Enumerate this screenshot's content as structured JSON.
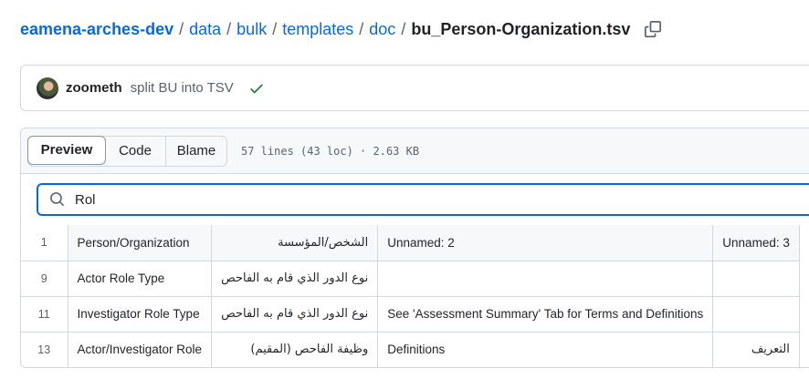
{
  "breadcrumb": {
    "repo": "eamena-arches-dev",
    "parts": [
      "data",
      "bulk",
      "templates",
      "doc"
    ],
    "file": "bu_Person-Organization.tsv",
    "separator": "/"
  },
  "commit": {
    "author": "zoometh",
    "message": "split BU into TSV",
    "status": "success"
  },
  "viewer": {
    "tabs": {
      "preview": "Preview",
      "code": "Code",
      "blame": "Blame"
    },
    "meta": "57 lines (43 loc) · 2.63 KB"
  },
  "search": {
    "value": "Rol"
  },
  "table": {
    "header": {
      "line": "1",
      "cells": [
        "Person/Organization",
        "الشخص/المؤسسة",
        "Unnamed: 2",
        "Unnamed: 3"
      ]
    },
    "rows": [
      {
        "line": "9",
        "cells": [
          "Actor Role Type",
          "نوع الدور الذي قام به الفاحص",
          "",
          ""
        ]
      },
      {
        "line": "11",
        "cells": [
          "Investigator Role Type",
          "نوع الدور الذي قام به الفاحص",
          "See 'Assessment Summary' Tab for Terms and Definitions",
          ""
        ]
      },
      {
        "line": "13",
        "cells": [
          "Actor/Investigator Role",
          "وظيفة الفاحص (المقيم)",
          "Definitions",
          "التعريف"
        ]
      }
    ]
  },
  "colors": {
    "link": "#0969da",
    "success": "#1a7f37",
    "border": "#d1d9e0",
    "focus": "#0969da"
  }
}
